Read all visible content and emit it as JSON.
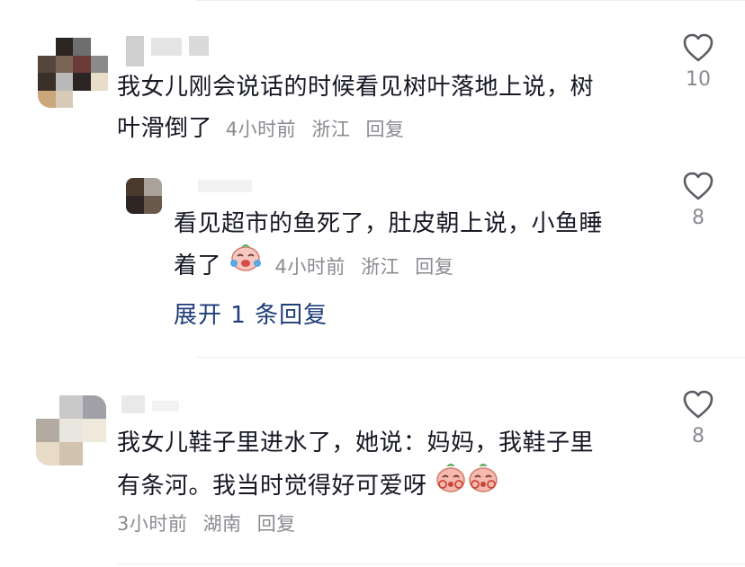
{
  "comments": [
    {
      "text_line1": "我女儿刚会说话的时候看见树叶落地上说，树",
      "text_line2": "叶滑倒了",
      "time": "4小时前",
      "location": "浙江",
      "reply_label": "回复",
      "likes": "10",
      "reply": {
        "text_line1": "看见超市的鱼死了，肚皮朝上说，小鱼睡",
        "text_line2": "着了",
        "time": "4小时前",
        "location": "浙江",
        "reply_label": "回复",
        "likes": "8",
        "emoji": "crying-laugh-emoji"
      },
      "expand_label": "展开 1 条回复"
    },
    {
      "text_line1": "我女儿鞋子里进水了，她说：妈妈，我鞋子里",
      "text_line2": "有条河。我当时觉得好可爱呀",
      "time": "3小时前",
      "location": "湖南",
      "reply_label": "回复",
      "likes": "8",
      "emoji": "peach-blush-emoji"
    }
  ],
  "colors": {
    "text": "#161823",
    "meta": "#8a8b91",
    "link": "#1f3d7a",
    "icon": "#5b5c63"
  },
  "icons": {
    "like": "heart-outline-icon"
  }
}
